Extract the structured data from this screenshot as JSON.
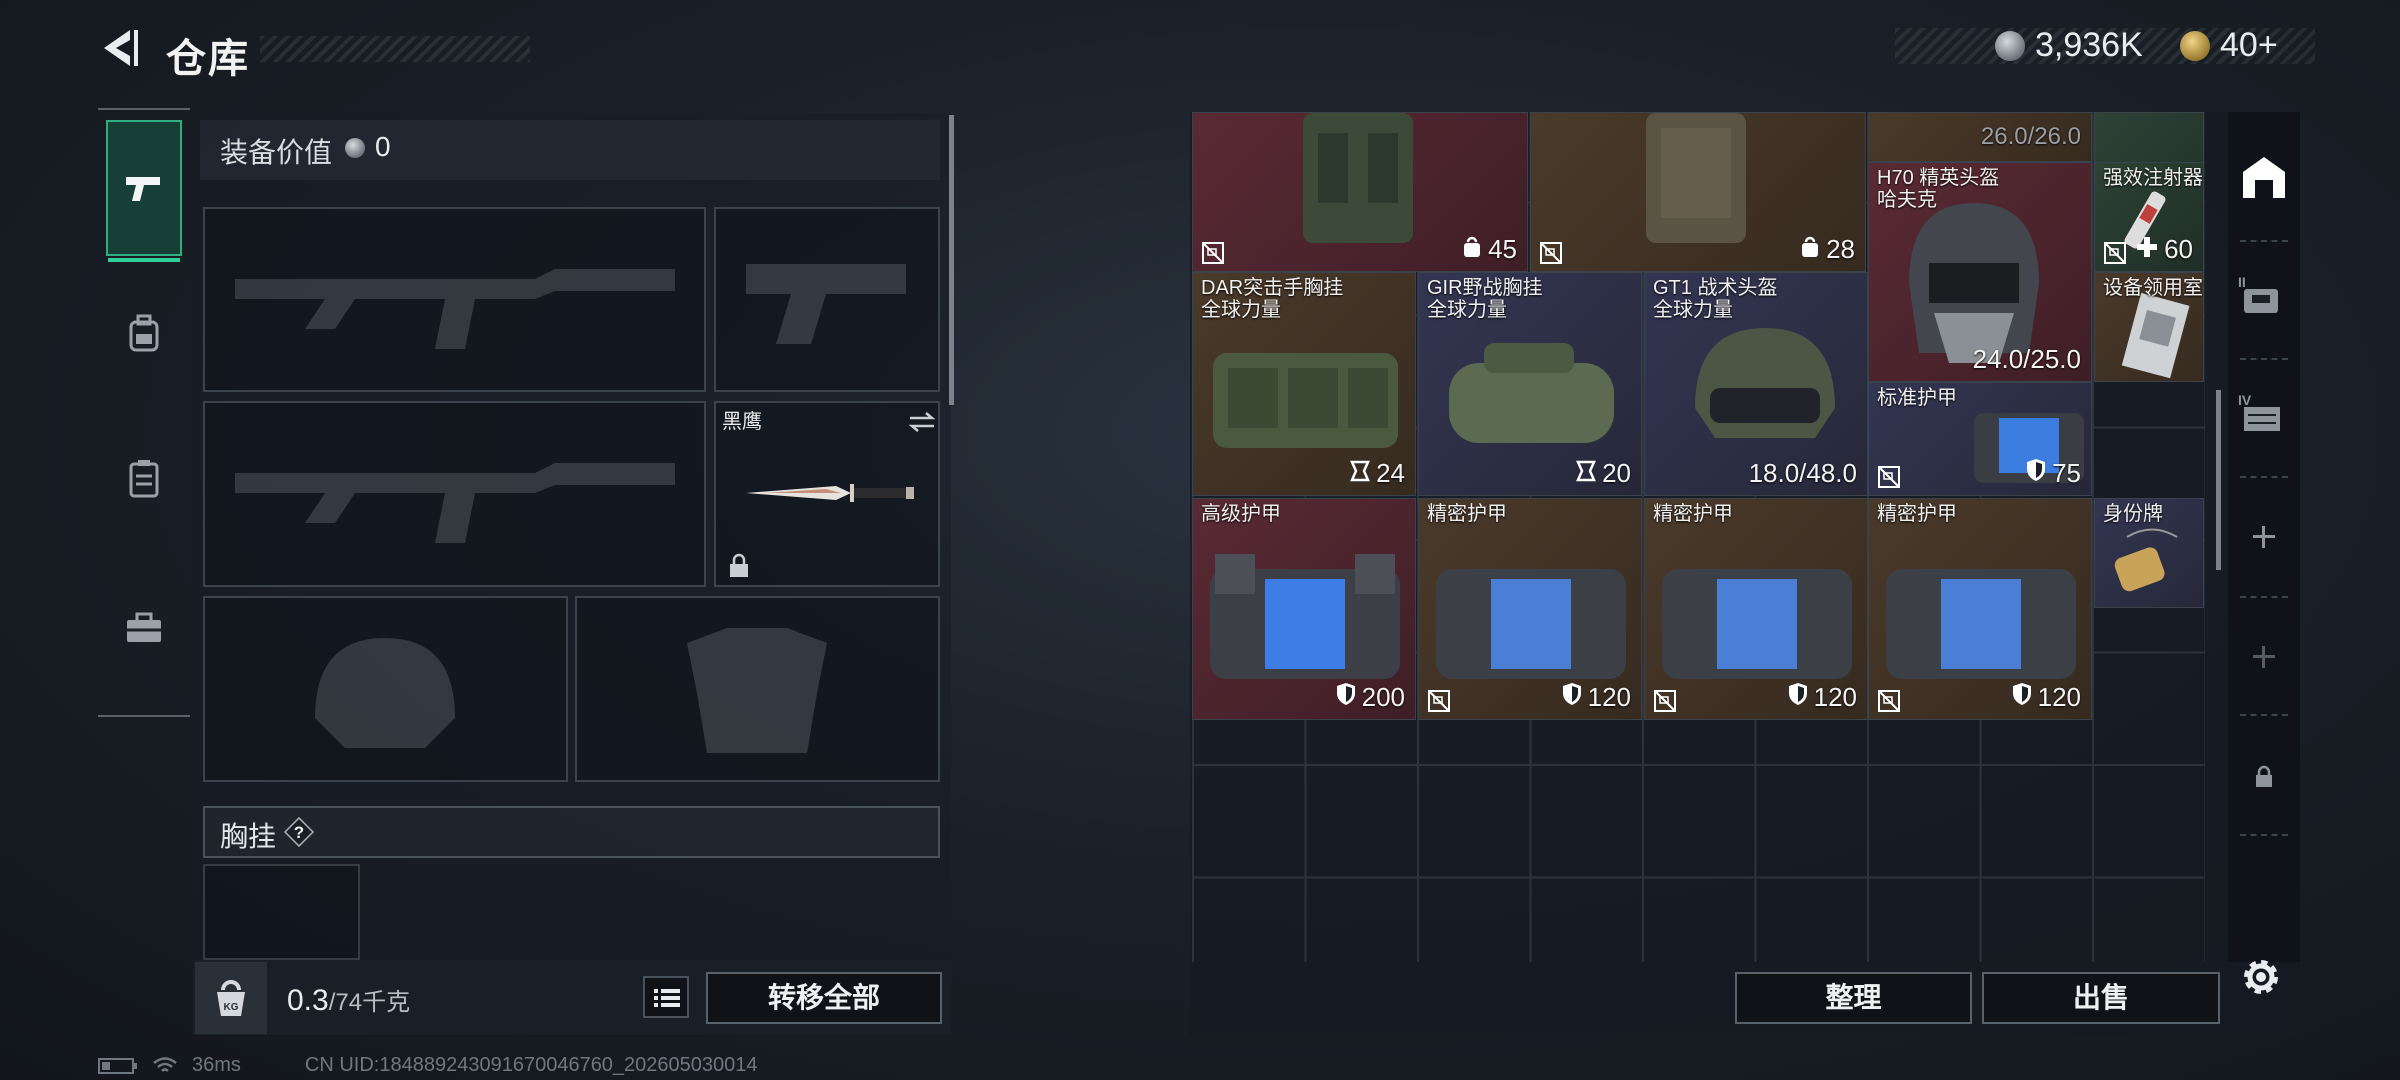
{
  "header": {
    "title": "仓库"
  },
  "currency": {
    "coins": "3,936K",
    "tokens": "40+"
  },
  "loadout": {
    "value_label": "装备价值",
    "value": "0",
    "knife_name": "黑鹰",
    "chest_label": "胸挂",
    "chest_help": "?",
    "weight_current": "0.3",
    "weight_max": "/74千克",
    "transfer_all": "转移全部"
  },
  "inventory": {
    "items": [
      {
        "name": "",
        "sub": "",
        "value": "45",
        "icon": "bag-icon",
        "color": "red",
        "nosell": true
      },
      {
        "name": "",
        "sub": "",
        "value": "28",
        "icon": "bag-icon",
        "color": "brown",
        "nosell": true
      },
      {
        "name": "",
        "sub": "",
        "value": "26.0/26.0",
        "icon": "",
        "color": "brown",
        "nosell": false
      },
      {
        "name": "",
        "sub": "",
        "value": "60",
        "icon": "plus-icon",
        "color": "green",
        "nosell": true
      },
      {
        "name": "H70 精英头盔",
        "sub": "哈夫克",
        "value": "24.0/25.0",
        "icon": "",
        "color": "red",
        "nosell": false
      },
      {
        "name": "强效注射器",
        "sub": "",
        "value": "60",
        "icon": "plus-icon",
        "color": "green",
        "nosell": true
      },
      {
        "name": "DAR突击手胸挂",
        "sub": "全球力量",
        "value": "24",
        "icon": "capacity-icon",
        "color": "brown",
        "nosell": false
      },
      {
        "name": "GIR野战胸挂",
        "sub": "全球力量",
        "value": "20",
        "icon": "capacity-icon",
        "color": "blue",
        "nosell": false
      },
      {
        "name": "GT1 战术头盔",
        "sub": "全球力量",
        "value": "18.0/48.0",
        "icon": "",
        "color": "blue",
        "nosell": false
      },
      {
        "name": "设备领用室",
        "sub": "",
        "value": "",
        "icon": "",
        "color": "brown",
        "nosell": false
      },
      {
        "name": "标准护甲",
        "sub": "",
        "value": "75",
        "icon": "shield-icon",
        "color": "blue",
        "nosell": true
      },
      {
        "name": "高级护甲",
        "sub": "",
        "value": "200",
        "icon": "shield-icon",
        "color": "red",
        "nosell": false
      },
      {
        "name": "精密护甲",
        "sub": "",
        "value": "120",
        "icon": "shield-icon",
        "color": "brown",
        "nosell": true
      },
      {
        "name": "精密护甲",
        "sub": "",
        "value": "120",
        "icon": "shield-icon",
        "color": "brown",
        "nosell": true
      },
      {
        "name": "精密护甲",
        "sub": "",
        "value": "120",
        "icon": "shield-icon",
        "color": "brown",
        "nosell": true
      },
      {
        "name": "身份牌",
        "sub": "",
        "value": "",
        "icon": "",
        "color": "blue",
        "nosell": false
      }
    ],
    "sort": "整理",
    "sell": "出售"
  },
  "status": {
    "ping": "36ms",
    "uid": "CN UID:1848892430916700467​60_202605030014"
  }
}
